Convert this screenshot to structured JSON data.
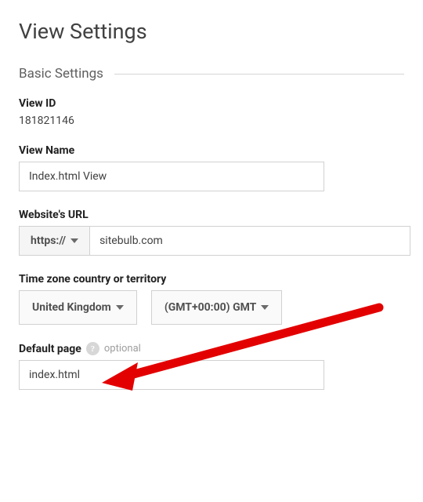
{
  "page_title": "View Settings",
  "section_title": "Basic Settings",
  "view_id": {
    "label": "View ID",
    "value": "181821146"
  },
  "view_name": {
    "label": "View Name",
    "value": "Index.html View"
  },
  "website_url": {
    "label": "Website's URL",
    "protocol": "https://",
    "domain": "sitebulb.com"
  },
  "timezone": {
    "label": "Time zone country or territory",
    "country": "United Kingdom",
    "zone": "(GMT+00:00) GMT"
  },
  "default_page": {
    "label": "Default page",
    "optional_text": "optional",
    "value": "index.html",
    "help_char": "?"
  },
  "arrow": {
    "color": "#e30000"
  }
}
